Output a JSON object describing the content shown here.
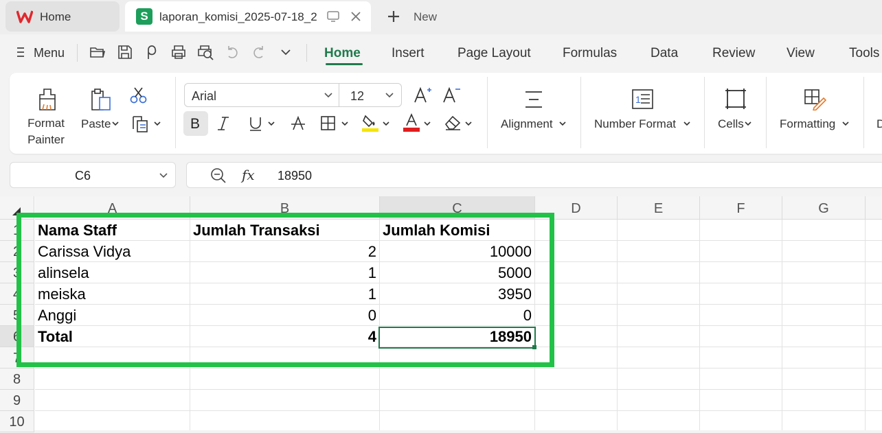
{
  "tabs": {
    "home_label": "Home",
    "file_label": "laporan_komisi_2025-07-18_2",
    "file_icon_letter": "S",
    "new_label": "New"
  },
  "menubar": {
    "menu_label": "Menu",
    "tabs": [
      "Home",
      "Insert",
      "Page Layout",
      "Formulas",
      "Data",
      "Review",
      "View",
      "Tools"
    ],
    "active_tab": "Home"
  },
  "ribbon": {
    "format_painter": "Format\nPainter",
    "format_painter_line1": "Format",
    "format_painter_line2": "Painter",
    "paste": "Paste",
    "font_name": "Arial",
    "font_size": "12",
    "bold": "B",
    "alignment": "Alignment",
    "number_format": "Number Format",
    "number_format_icon_text": "1☰",
    "cells": "Cells",
    "formatting": "Formatting",
    "more": "D",
    "fill_color": "#f5e400",
    "font_color": "#e01e1e"
  },
  "formula_bar": {
    "cell_ref": "C6",
    "fx": "fx",
    "value": "18950"
  },
  "sheet": {
    "columns": [
      "A",
      "B",
      "C",
      "D",
      "E",
      "F",
      "G"
    ],
    "selected_column": "C",
    "rows": [
      "1",
      "2",
      "3",
      "4",
      "5",
      "6",
      "7",
      "8",
      "9",
      "10"
    ],
    "headers": [
      "Nama Staff",
      "Jumlah Transaksi",
      "Jumlah Komisi"
    ],
    "data": [
      [
        "Carissa Vidya",
        "2",
        "10000"
      ],
      [
        "alinsela",
        "1",
        "5000"
      ],
      [
        "meiska",
        "1",
        "3950"
      ],
      [
        "Anggi",
        "0",
        "0"
      ]
    ],
    "total": [
      "Total",
      "4",
      "18950"
    ],
    "selected_cell": "C6",
    "highlight_color": "#21c247"
  }
}
